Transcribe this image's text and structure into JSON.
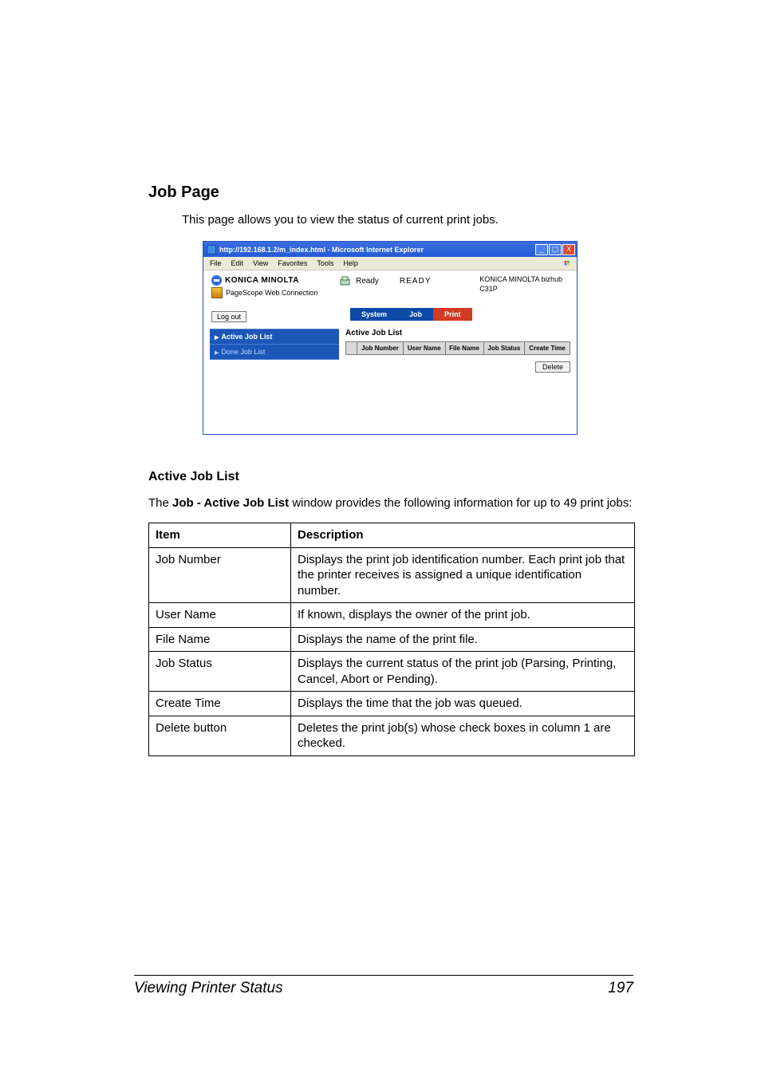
{
  "headings": {
    "job_page": "Job Page",
    "intro": "This page allows you to view the status of current print jobs.",
    "active_job_list": "Active Job List",
    "desc_prefix": "The ",
    "desc_bold": "Job - Active Job List",
    "desc_suffix": " window provides the following information for up to 49 print jobs:"
  },
  "ie": {
    "title": "http://192.168.1.2/m_index.html - Microsoft Internet Explorer",
    "menu": {
      "file": "File",
      "edit": "Edit",
      "view": "View",
      "favorites": "Favorites",
      "tools": "Tools",
      "help": "Help"
    },
    "win_min": "_",
    "win_max": "▢",
    "win_close": "X"
  },
  "app": {
    "brand": "KONICA MINOLTA",
    "pagescope": "PageScope Web Connection",
    "ready_small": "Ready",
    "ready_big": "READY",
    "model_line1": "KONICA MINOLTA bizhub",
    "model_line2": "C31P",
    "logout": "Log out",
    "tabs": {
      "system": "System",
      "job": "Job",
      "print": "Print"
    },
    "sidebar": {
      "active": "Active Job List",
      "done": "Done Job List"
    },
    "main_title": "Active Job List",
    "cols": {
      "num": "Job Number",
      "user": "User Name",
      "file": "File Name",
      "status": "Job Status",
      "time": "Create Time"
    },
    "delete": "Delete"
  },
  "table": {
    "head_item": "Item",
    "head_desc": "Description",
    "rows": [
      {
        "item": "Job Number",
        "desc": "Displays the print job identification number. Each print job that the printer receives is assigned a unique identification number."
      },
      {
        "item": "User Name",
        "desc": "If known, displays the owner of the print job."
      },
      {
        "item": "File Name",
        "desc": "Displays the name of the print file."
      },
      {
        "item": "Job Status",
        "desc": "Displays the current status of the print job (Parsing, Printing, Cancel, Abort or Pending)."
      },
      {
        "item": "Create Time",
        "desc": "Displays the time that the job was queued."
      },
      {
        "item": "Delete button",
        "desc": "Deletes the print job(s) whose check boxes in column 1 are checked."
      }
    ]
  },
  "footer": {
    "title": "Viewing Printer Status",
    "page": "197"
  }
}
